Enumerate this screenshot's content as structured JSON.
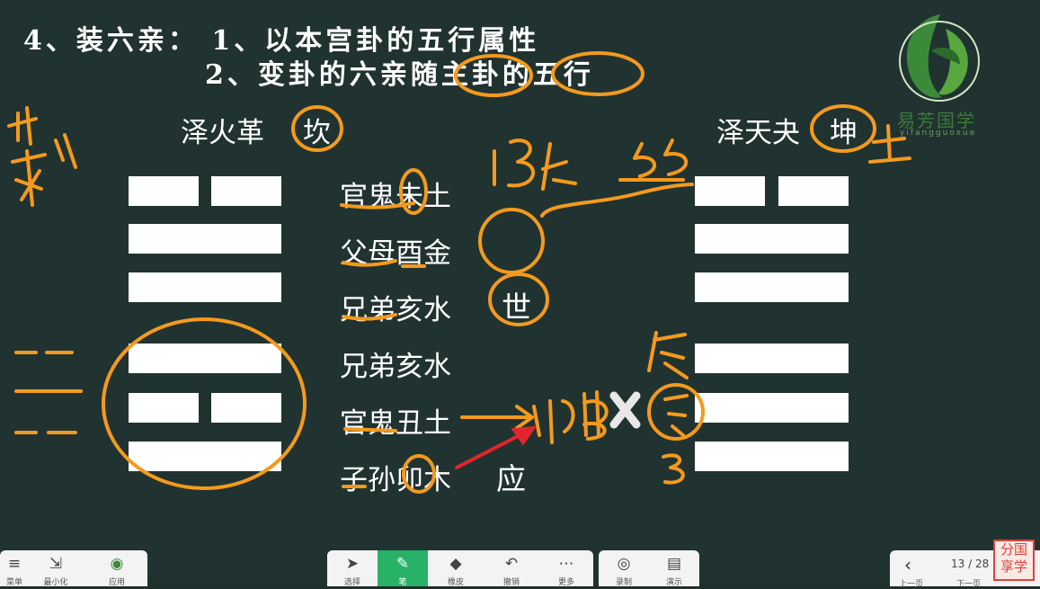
{
  "heading": {
    "line1": "4、装六亲： 1、以本宫卦的五行属性",
    "line2": "2、变卦的六亲随主卦的五行"
  },
  "left_gua": {
    "name": "泽火革",
    "palace": "坎"
  },
  "right_gua": {
    "name": "泽天夬",
    "palace": "坤"
  },
  "lines": [
    {
      "label": "官鬼未土"
    },
    {
      "label": "父母酉金"
    },
    {
      "label": "兄弟亥水"
    },
    {
      "label": "兄弟亥水"
    },
    {
      "label": "官鬼丑土"
    },
    {
      "label": "子孙卯木"
    }
  ],
  "marks": {
    "shi": "世",
    "ying": "应"
  },
  "handwriting": {
    "left_note": "水 我",
    "n1": "135.",
    "n2": "55",
    "fu": "父",
    "tu": "土.",
    "chen": "辰",
    "yin": "寅",
    "three": "3"
  },
  "logo": {
    "text": "易芳国学",
    "sub": "yifangguoxue"
  },
  "toolbar_left": [
    {
      "icon": "menu-icon",
      "label": "菜单"
    },
    {
      "icon": "minimize-icon",
      "label": "最小化"
    },
    {
      "icon": "app-icon",
      "label": "应用"
    }
  ],
  "toolbar_center": [
    {
      "icon": "cursor-icon",
      "label": "选择",
      "active": false
    },
    {
      "icon": "pen-icon",
      "label": "笔",
      "active": true
    },
    {
      "icon": "eraser-icon",
      "label": "橡皮",
      "active": false
    },
    {
      "icon": "undo-icon",
      "label": "撤销",
      "active": false
    },
    {
      "icon": "more-icon",
      "label": "更多",
      "active": false
    }
  ],
  "toolbar_right": [
    {
      "icon": "record-icon",
      "label": "录制"
    },
    {
      "icon": "present-icon",
      "label": "演示"
    }
  ],
  "pager": {
    "page": "13 / 28",
    "prev_label": "上一页",
    "next_label": "下一页"
  },
  "stamp": {
    "line1": "分国",
    "line2": "享学"
  },
  "colors": {
    "board": "#213330",
    "ink": "#f39a1e",
    "arrow": "#e0262c",
    "accent": "#27b267"
  }
}
